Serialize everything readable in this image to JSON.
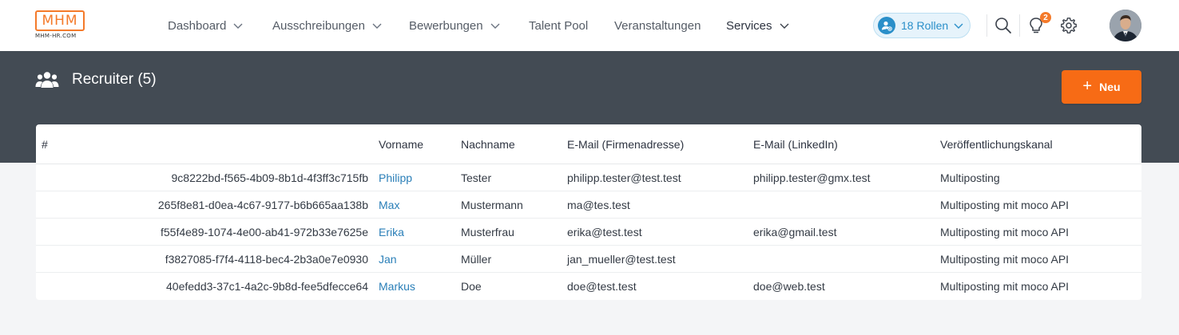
{
  "logo": {
    "text": "MHM",
    "sub": "MHM-HR.COM"
  },
  "nav": {
    "items": [
      {
        "label": "Dashboard",
        "has_dropdown": true
      },
      {
        "label": "Ausschreibungen",
        "has_dropdown": true
      },
      {
        "label": "Bewerbungen",
        "has_dropdown": true
      },
      {
        "label": "Talent Pool",
        "has_dropdown": false
      },
      {
        "label": "Veranstaltungen",
        "has_dropdown": false
      },
      {
        "label": "Services",
        "has_dropdown": true
      }
    ]
  },
  "roles": {
    "label": "18 Rollen"
  },
  "notifications": {
    "count": "2"
  },
  "icons": {
    "search": "search-icon",
    "ideas": "lightbulb-icon",
    "settings": "gear-icon",
    "users": "users-icon"
  },
  "colors": {
    "accent": "#f76b15",
    "link": "#2a7fb8",
    "band": "#434b54",
    "roles": "#2a8fc9"
  },
  "page": {
    "title": "Recruiter (5)",
    "new_button": "Neu"
  },
  "table": {
    "headers": [
      "#",
      "Vorname",
      "Nachname",
      "E-Mail (Firmenadresse)",
      "E-Mail (LinkedIn)",
      "Veröffentlichungskanal"
    ],
    "rows": [
      {
        "id": "9c8222bd-f565-4b09-8b1d-4f3ff3c715fb",
        "first": "Philipp",
        "last": "Tester",
        "email": "philipp.tester@test.test",
        "linkedin": "philipp.tester@gmx.test",
        "channel": "Multiposting"
      },
      {
        "id": "265f8e81-d0ea-4c67-9177-b6b665aa138b",
        "first": "Max",
        "last": "Mustermann",
        "email": "ma@tes.test",
        "linkedin": "",
        "channel": "Multiposting mit moco API"
      },
      {
        "id": "f55f4e89-1074-4e00-ab41-972b33e7625e",
        "first": "Erika",
        "last": "Musterfrau",
        "email": "erika@test.test",
        "linkedin": "erika@gmail.test",
        "channel": "Multiposting mit moco API"
      },
      {
        "id": "f3827085-f7f4-4118-bec4-2b3a0e7e0930",
        "first": "Jan",
        "last": "Müller",
        "email": "jan_mueller@test.test",
        "linkedin": "",
        "channel": "Multiposting mit moco API"
      },
      {
        "id": "40efedd3-37c1-4a2c-9b8d-fee5dfecce64",
        "first": "Markus",
        "last": "Doe",
        "email": "doe@test.test",
        "linkedin": "doe@web.test",
        "channel": "Multiposting mit moco API"
      }
    ]
  }
}
